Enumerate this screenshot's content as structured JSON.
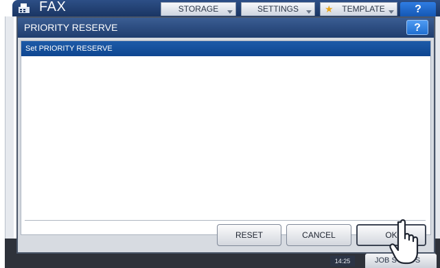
{
  "app": {
    "title": "FAX",
    "tabs": [
      {
        "label": "STORAGE"
      },
      {
        "label": "SETTINGS"
      },
      {
        "label": "TEMPLATE"
      }
    ],
    "help_label": "?"
  },
  "dialog": {
    "title": "PRIORITY RESERVE",
    "help_label": "?",
    "list_header": "Set PRIORITY RESERVE",
    "buttons": {
      "reset": "RESET",
      "cancel": "CANCEL",
      "ok": "OK"
    }
  },
  "status": {
    "time": "14:25",
    "job_label": "JOB STATUS"
  },
  "colors": {
    "header_blue": "#1a3563",
    "list_header_blue": "#0e4690",
    "help_blue": "#1f6fd1"
  },
  "icons": [
    "fax-icon",
    "star-icon",
    "help-icon",
    "hand-pointer-icon"
  ]
}
